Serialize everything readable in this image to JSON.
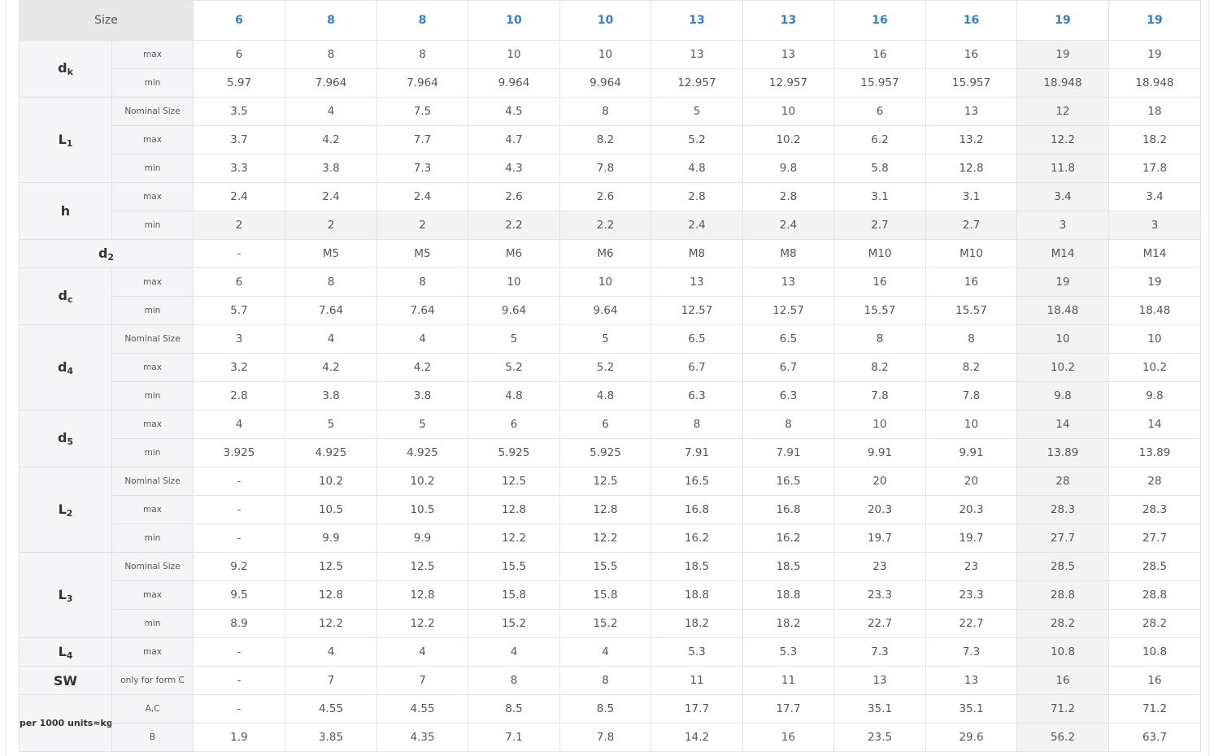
{
  "header": {
    "size_label": "Size",
    "sizes": [
      "6",
      "8",
      "8",
      "10",
      "10",
      "13",
      "13",
      "16",
      "16",
      "19",
      "19"
    ]
  },
  "groups": [
    {
      "symbol": "d",
      "subscript": "k",
      "rows": [
        {
          "label": "max",
          "values": [
            "6",
            "8",
            "8",
            "10",
            "10",
            "13",
            "13",
            "16",
            "16",
            "19",
            "19"
          ]
        },
        {
          "label": "min",
          "values": [
            "5.97",
            "7.964",
            "7.964",
            "9.964",
            "9.964",
            "12.957",
            "12.957",
            "15.957",
            "15.957",
            "18.948",
            "18.948"
          ]
        }
      ]
    },
    {
      "symbol": "L",
      "subscript": "1",
      "rows": [
        {
          "label": "Nominal Size",
          "values": [
            "3.5",
            "4",
            "7.5",
            "4.5",
            "8",
            "5",
            "10",
            "6",
            "13",
            "12",
            "18"
          ]
        },
        {
          "label": "max",
          "values": [
            "3.7",
            "4.2",
            "7.7",
            "4.7",
            "8.2",
            "5.2",
            "10.2",
            "6.2",
            "13.2",
            "12.2",
            "18.2"
          ]
        },
        {
          "label": "min",
          "values": [
            "3.3",
            "3.8",
            "7.3",
            "4.3",
            "7.8",
            "4.8",
            "9.8",
            "5.8",
            "12.8",
            "11.8",
            "17.8"
          ]
        }
      ]
    },
    {
      "symbol": "h",
      "subscript": "",
      "rows": [
        {
          "label": "max",
          "values": [
            "2.4",
            "2.4",
            "2.4",
            "2.6",
            "2.6",
            "2.8",
            "2.8",
            "3.1",
            "3.1",
            "3.4",
            "3.4"
          ]
        },
        {
          "label": "min",
          "values": [
            "2",
            "2",
            "2",
            "2.2",
            "2.2",
            "2.4",
            "2.4",
            "2.7",
            "2.7",
            "3",
            "3"
          ]
        }
      ]
    },
    {
      "symbol": "d",
      "subscript": "2",
      "wide": true,
      "rows": [
        {
          "label": "",
          "values": [
            "-",
            "M5",
            "M5",
            "M6",
            "M6",
            "M8",
            "M8",
            "M10",
            "M10",
            "M14",
            "M14"
          ]
        }
      ]
    },
    {
      "symbol": "d",
      "subscript": "c",
      "rows": [
        {
          "label": "max",
          "values": [
            "6",
            "8",
            "8",
            "10",
            "10",
            "13",
            "13",
            "16",
            "16",
            "19",
            "19"
          ]
        },
        {
          "label": "min",
          "values": [
            "5.7",
            "7.64",
            "7.64",
            "9.64",
            "9.64",
            "12.57",
            "12.57",
            "15.57",
            "15.57",
            "18.48",
            "18.48"
          ]
        }
      ]
    },
    {
      "symbol": "d",
      "subscript": "4",
      "rows": [
        {
          "label": "Nominal Size",
          "values": [
            "3",
            "4",
            "4",
            "5",
            "5",
            "6.5",
            "6.5",
            "8",
            "8",
            "10",
            "10"
          ]
        },
        {
          "label": "max",
          "values": [
            "3.2",
            "4.2",
            "4.2",
            "5.2",
            "5.2",
            "6.7",
            "6.7",
            "8.2",
            "8.2",
            "10.2",
            "10.2"
          ]
        },
        {
          "label": "min",
          "values": [
            "2.8",
            "3.8",
            "3.8",
            "4.8",
            "4.8",
            "6.3",
            "6.3",
            "7.8",
            "7.8",
            "9.8",
            "9.8"
          ]
        }
      ]
    },
    {
      "symbol": "d",
      "subscript": "5",
      "rows": [
        {
          "label": "max",
          "values": [
            "4",
            "5",
            "5",
            "6",
            "6",
            "8",
            "8",
            "10",
            "10",
            "14",
            "14"
          ]
        },
        {
          "label": "min",
          "values": [
            "3.925",
            "4.925",
            "4.925",
            "5.925",
            "5.925",
            "7.91",
            "7.91",
            "9.91",
            "9.91",
            "13.89",
            "13.89"
          ]
        }
      ]
    },
    {
      "symbol": "L",
      "subscript": "2",
      "rows": [
        {
          "label": "Nominal Size",
          "values": [
            "-",
            "10.2",
            "10.2",
            "12.5",
            "12.5",
            "16.5",
            "16.5",
            "20",
            "20",
            "28",
            "28"
          ]
        },
        {
          "label": "max",
          "values": [
            "-",
            "10.5",
            "10.5",
            "12.8",
            "12.8",
            "16.8",
            "16.8",
            "20.3",
            "20.3",
            "28.3",
            "28.3"
          ]
        },
        {
          "label": "min",
          "values": [
            "-",
            "9.9",
            "9.9",
            "12.2",
            "12.2",
            "16.2",
            "16.2",
            "19.7",
            "19.7",
            "27.7",
            "27.7"
          ]
        }
      ]
    },
    {
      "symbol": "L",
      "subscript": "3",
      "rows": [
        {
          "label": "Nominal Size",
          "values": [
            "9.2",
            "12.5",
            "12.5",
            "15.5",
            "15.5",
            "18.5",
            "18.5",
            "23",
            "23",
            "28.5",
            "28.5"
          ]
        },
        {
          "label": "max",
          "values": [
            "9.5",
            "12.8",
            "12.8",
            "15.8",
            "15.8",
            "18.8",
            "18.8",
            "23.3",
            "23.3",
            "28.8",
            "28.8"
          ]
        },
        {
          "label": "min",
          "values": [
            "8.9",
            "12.2",
            "12.2",
            "15.2",
            "15.2",
            "18.2",
            "18.2",
            "22.7",
            "22.7",
            "28.2",
            "28.2"
          ]
        }
      ]
    },
    {
      "symbol": "L",
      "subscript": "4",
      "rows": [
        {
          "label": "max",
          "values": [
            "-",
            "4",
            "4",
            "4",
            "4",
            "5.3",
            "5.3",
            "7.3",
            "7.3",
            "10.8",
            "10.8"
          ]
        }
      ]
    },
    {
      "symbol": "SW",
      "subscript": "",
      "rows": [
        {
          "label": "only for form C",
          "values": [
            "-",
            "7",
            "7",
            "8",
            "8",
            "11",
            "11",
            "13",
            "13",
            "16",
            "16"
          ]
        }
      ]
    },
    {
      "symbol": "per 1000 units≈kg",
      "subscript": "",
      "small": true,
      "rows": [
        {
          "label": "A,C",
          "values": [
            "-",
            "4.55",
            "4.55",
            "8.5",
            "8.5",
            "17.7",
            "17.7",
            "35.1",
            "35.1",
            "71.2",
            "71.2"
          ]
        },
        {
          "label": "B",
          "values": [
            "1.9",
            "3.85",
            "4.35",
            "7.1",
            "7.8",
            "14.2",
            "16",
            "23.5",
            "29.6",
            "56.2",
            "63.7"
          ]
        }
      ]
    }
  ],
  "highlight": {
    "column_index": 9,
    "row_key": "h-min"
  }
}
